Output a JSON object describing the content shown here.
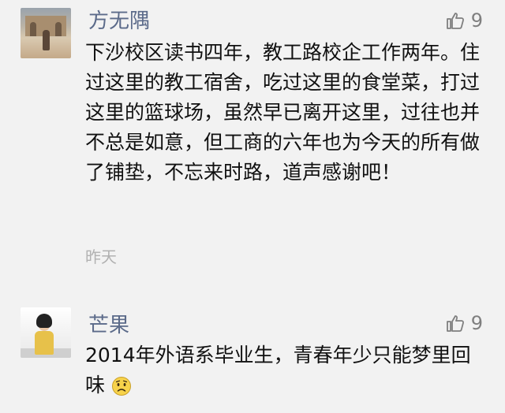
{
  "comments": [
    {
      "name": "方无隅",
      "likes": "9",
      "content": "下沙校区读书四年，教工路校企工作两年。住过这里的教工宿舍，吃过这里的食堂菜，打过这里的篮球场，虽然早已离开这里，过往也并不总是如意，但工商的六年也为今天的所有做了铺垫，不忘来时路，道声感谢吧！",
      "time": "昨天"
    },
    {
      "name": "芒果",
      "likes": "9",
      "content": "2014年外语系毕业生，青春年少只能梦里回味"
    }
  ],
  "colors": {
    "background": "#f2f2f2",
    "name": "#5c6b8a",
    "meta": "#7f7f7f",
    "time": "#b1b1b1"
  },
  "icons": {
    "like": "thumbs-up-icon",
    "emoji": "worried-face-emoji"
  }
}
